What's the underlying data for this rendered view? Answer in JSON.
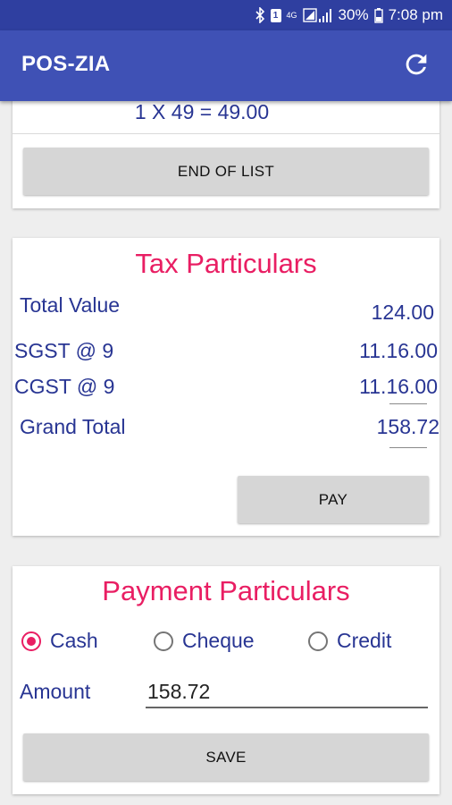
{
  "status_bar": {
    "network": "4G",
    "battery_percent": "30%",
    "time": "7:08 pm",
    "sim_slot": "1",
    "icons": [
      "bluetooth-icon",
      "sim-icon",
      "signal-icon",
      "battery-icon"
    ]
  },
  "app_bar": {
    "title": "POS-ZIA",
    "refresh_icon": "refresh-icon"
  },
  "order_list": {
    "last_item": "1 X 49 = 49.00",
    "end_button": "END OF LIST"
  },
  "tax": {
    "title": "Tax Particulars",
    "rows": [
      {
        "label": "Total Value",
        "value": "124.00"
      },
      {
        "label": "SGST @ 9",
        "value": "11.16.00"
      },
      {
        "label": "CGST @ 9",
        "value": "11.16.00"
      },
      {
        "label": "Grand Total",
        "value": "158.72"
      }
    ],
    "pay_button": "PAY"
  },
  "payment": {
    "title": "Payment Particulars",
    "options": [
      {
        "label": "Cash",
        "selected": true
      },
      {
        "label": "Cheque",
        "selected": false
      },
      {
        "label": "Credit",
        "selected": false
      }
    ],
    "amount_label": "Amount",
    "amount_value": "158.72",
    "save_button": "SAVE"
  },
  "colors": {
    "primary": "#3f51b5",
    "primary_dark": "#2f3fa0",
    "accent": "#e91e63",
    "text_blue": "#283593",
    "button_gray": "#d6d6d6"
  }
}
